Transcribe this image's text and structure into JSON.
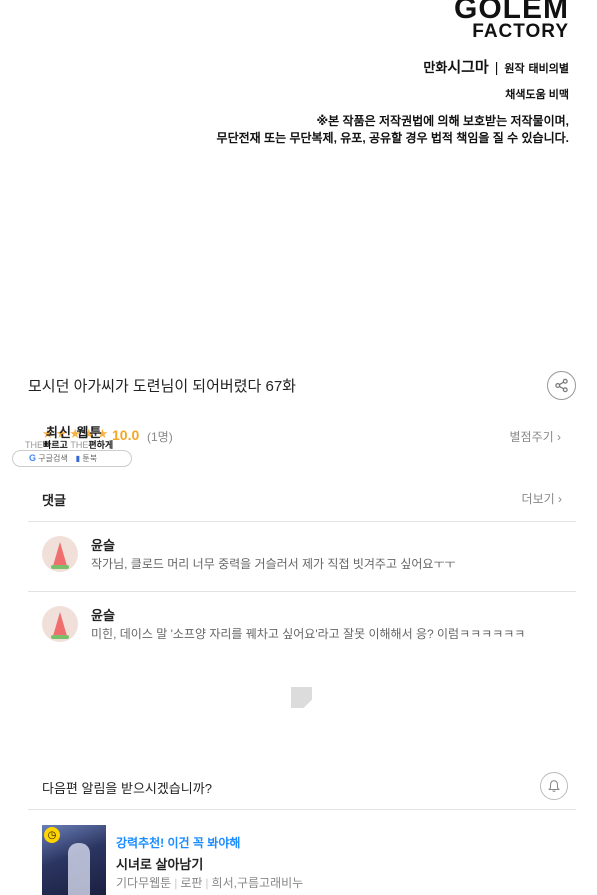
{
  "credits": {
    "logo_line1": "GOLEM",
    "logo_line2": "FACTORY",
    "artist_label": "만화",
    "artist_name": "시그마",
    "author_label": "원작",
    "author_name": "태비의별",
    "colorist_label": "채색도움",
    "colorist_name": "비맥",
    "copyright_line1": "※본 작품은 저작권법에 의해 보호받는 저작물이며,",
    "copyright_line2": "무단전재 또는 무단복제, 유포, 공유할 경우 법적 책임을 질 수 있습니다."
  },
  "episode": {
    "title": "모시던 아가씨가 도련님이 되어버렸다 67화"
  },
  "rating": {
    "latest_label": "최신 웹툰",
    "stars": "★★★★★",
    "score": "10.0",
    "count": "(1명)",
    "rate_link": "별점주기 ›"
  },
  "ad": {
    "line_prefix1": "THE",
    "line_word1": "빠르고",
    "line_prefix2": "THE",
    "line_word2": "편하게",
    "google_g": "G",
    "google_label": "구글검색",
    "book_label": "툰북"
  },
  "comments": {
    "header": "댓글",
    "more": "더보기 ›",
    "items": [
      {
        "name": "윤슬",
        "text": "작가님, 클로드 머리 너무 중력을 거슬러서 제가 직접 빗겨주고 싶어요ㅜㅜ"
      },
      {
        "name": "윤슬",
        "text": "미힌, 데이스 말 '소프양 자리를 꿰차고 싶어요'라고 잘못 이해해서 응? 이럼ㅋㅋㅋㅋㅋㅋ"
      }
    ]
  },
  "alert": {
    "question": "다음편 알림을 받으시겠습니까?"
  },
  "recommendation": {
    "kicker": "강력추천! 이건 꼭 봐야해",
    "title": "시녀로 살아남기",
    "platform": "기다무웹툰",
    "genre": "로판",
    "creators": "희서,구름고래비누"
  },
  "colors": {
    "accent_blue": "#1a8cff",
    "star_orange": "#f5a623",
    "divider": "#e2e2e2"
  },
  "icons": [
    "share-icon",
    "bell-icon",
    "clock-badge-icon",
    "placeholder-image-icon",
    "watermelon-avatar-icon"
  ]
}
